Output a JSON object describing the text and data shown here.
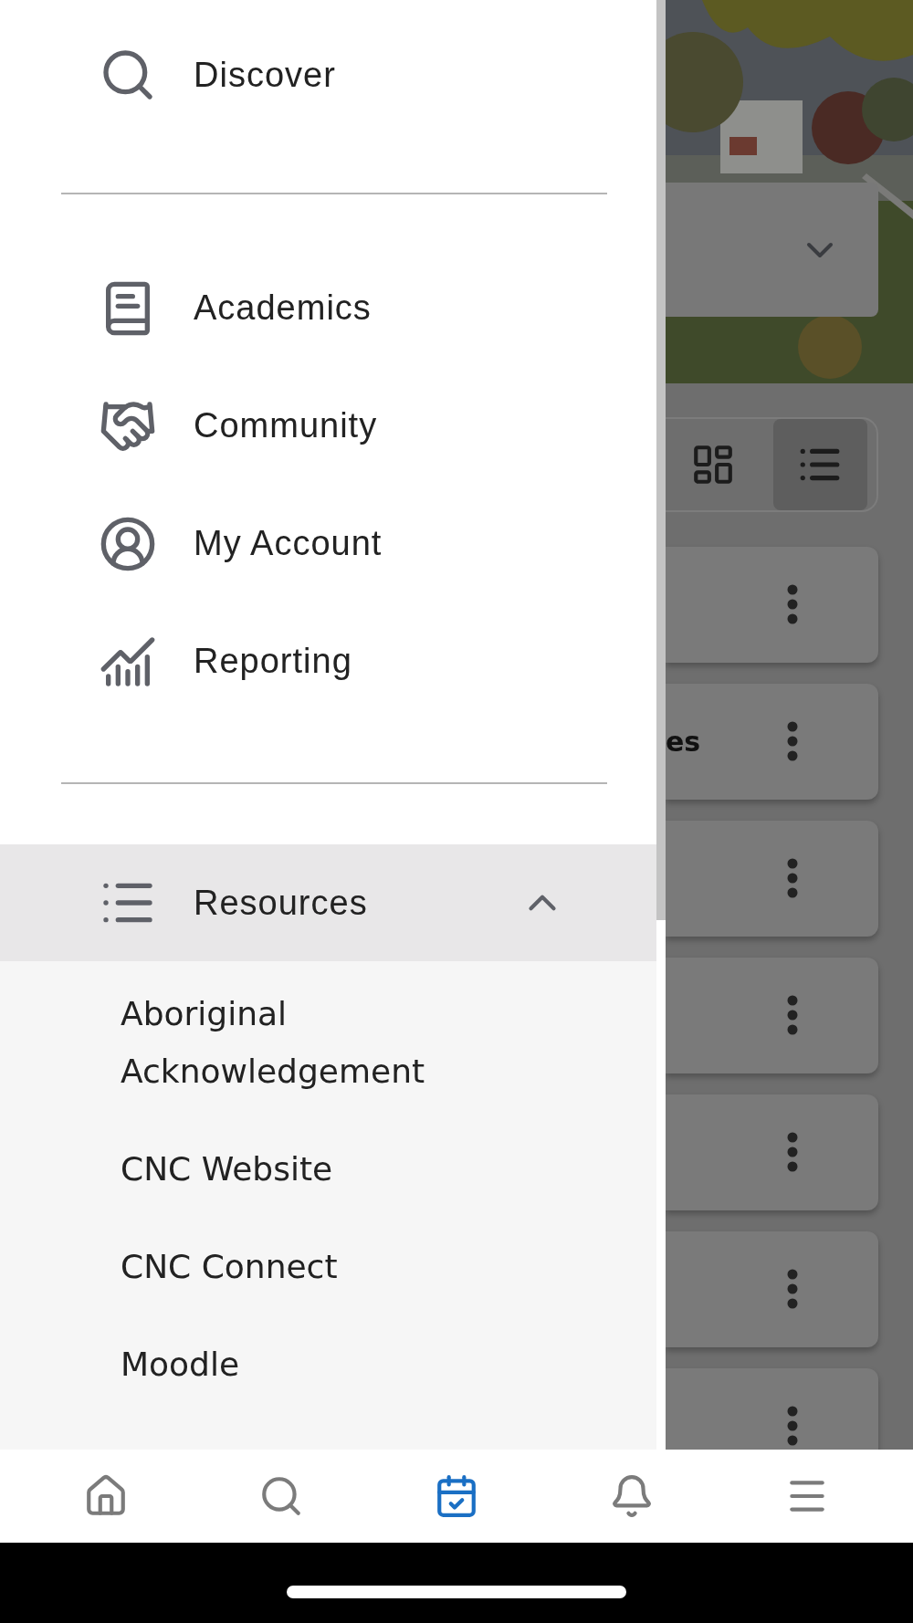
{
  "drawer": {
    "top_items": [
      {
        "kind": "search",
        "label": "Discover"
      }
    ],
    "main_items": [
      {
        "kind": "book",
        "label": "Academics"
      },
      {
        "kind": "handshake",
        "label": "Community"
      },
      {
        "kind": "account",
        "label": "My Account"
      },
      {
        "kind": "chart",
        "label": "Reporting"
      }
    ],
    "resources": {
      "kind": "list",
      "label": "Resources",
      "expanded": true,
      "children": [
        {
          "label": "Aboriginal Acknowledgement"
        },
        {
          "label": "CNC Website"
        },
        {
          "label": "CNC Connect"
        },
        {
          "label": "Moodle"
        }
      ]
    }
  },
  "background": {
    "view_toggle": [
      {
        "kind": "grid",
        "selected": false
      },
      {
        "kind": "list",
        "selected": true
      }
    ],
    "cards": [
      {
        "kind": "menu"
      },
      {
        "kind": "menu",
        "text": "es"
      },
      {
        "kind": "menu"
      },
      {
        "kind": "menu"
      },
      {
        "kind": "menu"
      },
      {
        "kind": "menu"
      },
      {
        "kind": "menu"
      }
    ]
  },
  "bottom_nav": [
    {
      "kind": "home",
      "selected": false
    },
    {
      "kind": "search",
      "selected": false
    },
    {
      "kind": "calendar",
      "selected": true
    },
    {
      "kind": "bell",
      "selected": false
    },
    {
      "kind": "menu",
      "selected": false
    }
  ]
}
